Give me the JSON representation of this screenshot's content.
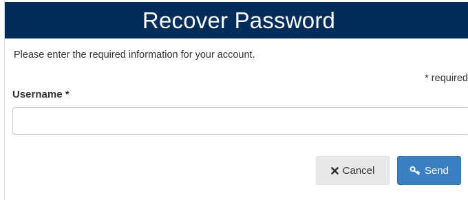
{
  "header": {
    "title": "Recover Password"
  },
  "form": {
    "intro": "Please enter the required information for your account.",
    "required_note": "* required",
    "username": {
      "label": "Username",
      "required_marker": "*",
      "value": "",
      "placeholder": ""
    }
  },
  "actions": {
    "cancel_label": "Cancel",
    "cancel_icon": "times-icon",
    "send_label": "Send",
    "send_icon": "key-icon"
  },
  "colors": {
    "header_bg": "#002d5a",
    "send_bg": "#3a7fc2",
    "cancel_bg": "#e8e8e8"
  }
}
